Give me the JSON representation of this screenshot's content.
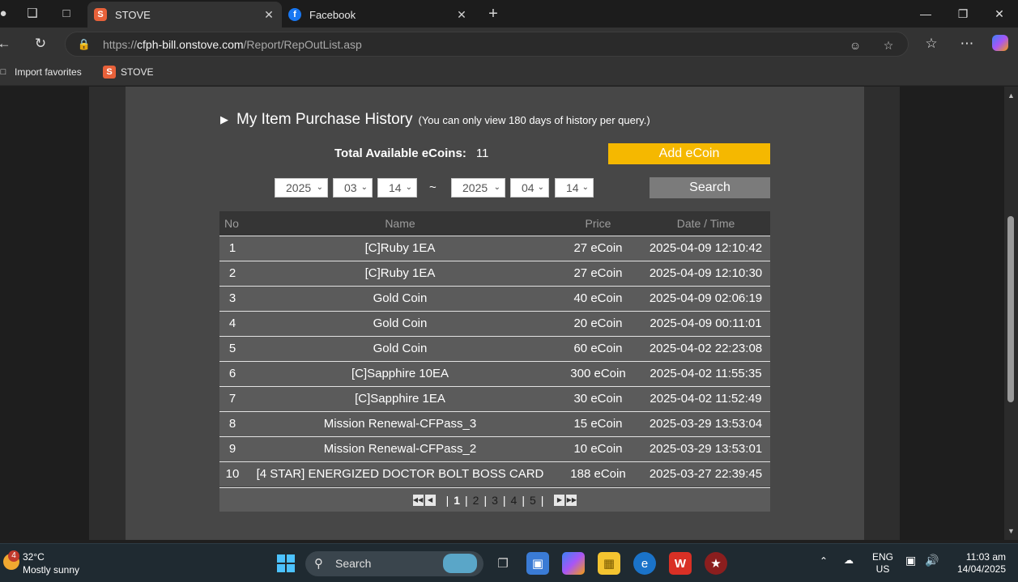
{
  "browser": {
    "tabs": [
      {
        "title": "STOVE",
        "favicon_letter": "S",
        "active": true
      },
      {
        "title": "Facebook",
        "favicon_letter": "f",
        "active": false
      }
    ],
    "url_prefix": "https://",
    "url_host": "cfph-bill.onstove.com",
    "url_path": "/Report/RepOutList.asp",
    "favorites": [
      {
        "label": "Import favorites"
      },
      {
        "label": "STOVE",
        "favicon_letter": "S"
      }
    ]
  },
  "page": {
    "title": "My Item Purchase History",
    "note": "(You can only view 180 days of history per query.)",
    "coins_label": "Total Available eCoins:",
    "coins_value": "11",
    "add_button": "Add eCoin",
    "search_button": "Search",
    "tilde": "~",
    "date_from": {
      "year": "2025",
      "month": "03",
      "day": "14"
    },
    "date_to": {
      "year": "2025",
      "month": "04",
      "day": "14"
    },
    "columns": [
      "No",
      "Name",
      "Price",
      "Date / Time"
    ],
    "rows": [
      {
        "no": "1",
        "name": "[C]Ruby 1EA",
        "price": "27 eCoin",
        "date": "2025-04-09 12:10:42"
      },
      {
        "no": "2",
        "name": "[C]Ruby 1EA",
        "price": "27 eCoin",
        "date": "2025-04-09 12:10:30"
      },
      {
        "no": "3",
        "name": "Gold Coin",
        "price": "40 eCoin",
        "date": "2025-04-09 02:06:19"
      },
      {
        "no": "4",
        "name": "Gold Coin",
        "price": "20 eCoin",
        "date": "2025-04-09 00:11:01"
      },
      {
        "no": "5",
        "name": "Gold Coin",
        "price": "60 eCoin",
        "date": "2025-04-02 22:23:08"
      },
      {
        "no": "6",
        "name": "[C]Sapphire 10EA",
        "price": "300 eCoin",
        "date": "2025-04-02 11:55:35"
      },
      {
        "no": "7",
        "name": "[C]Sapphire 1EA",
        "price": "30 eCoin",
        "date": "2025-04-02 11:52:49"
      },
      {
        "no": "8",
        "name": "Mission Renewal-CFPass_3",
        "price": "15 eCoin",
        "date": "2025-03-29 13:53:04"
      },
      {
        "no": "9",
        "name": "Mission Renewal-CFPass_2",
        "price": "10 eCoin",
        "date": "2025-03-29 13:53:01"
      },
      {
        "no": "10",
        "name": "[4 STAR] ENERGIZED DOCTOR BOLT BOSS CARD",
        "price": "188 eCoin",
        "date": "2025-03-27 22:39:45"
      }
    ],
    "pages": [
      "1",
      "2",
      "3",
      "4",
      "5"
    ],
    "current_page": "1"
  },
  "taskbar": {
    "weather_badge": "4",
    "temperature": "32°C",
    "condition": "Mostly sunny",
    "search_label": "Search",
    "language": "ENG",
    "region": "US",
    "time": "11:03 am",
    "date": "14/04/2025"
  },
  "colors": {
    "accent_add": "#f5b800",
    "search_button": "#7b7b7b",
    "table_row": "#5b5b5b",
    "table_header": "#353535"
  }
}
